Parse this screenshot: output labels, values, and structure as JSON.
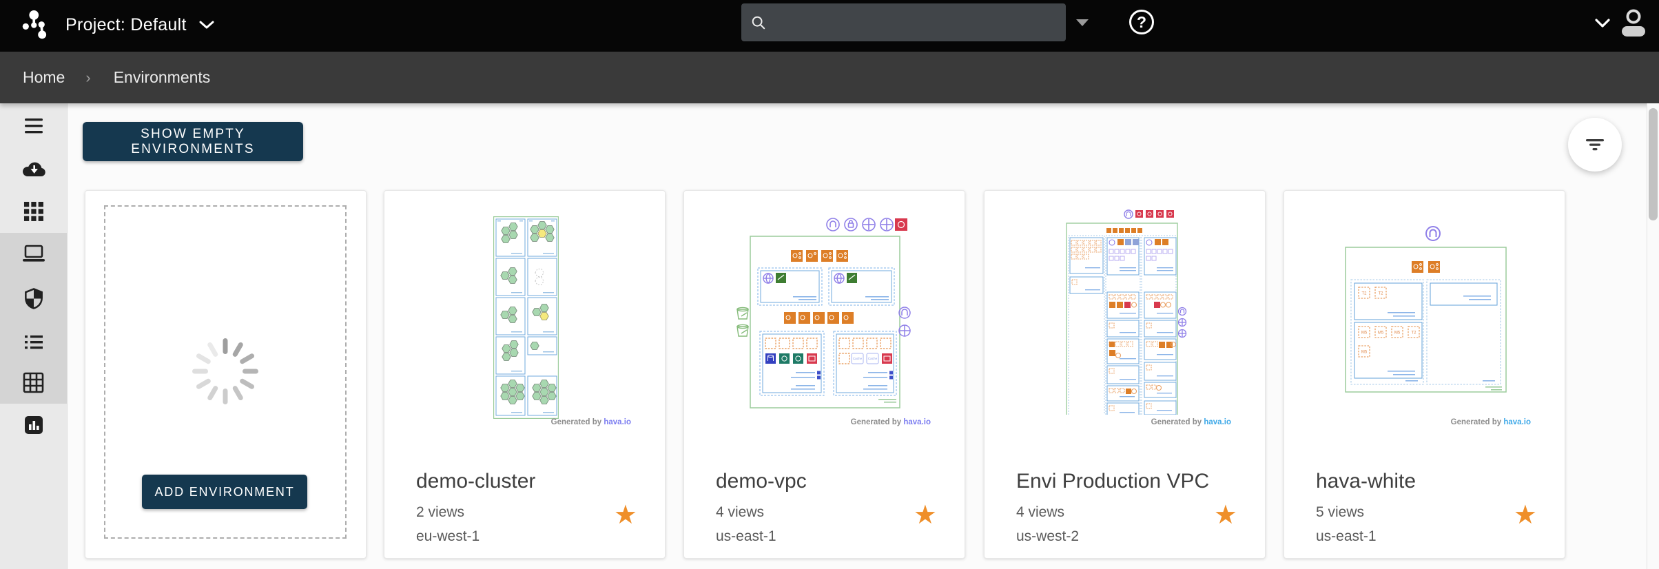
{
  "navbar": {
    "project_label": "Project: Default",
    "search": {
      "value": "",
      "placeholder": ""
    },
    "help_glyph": "?",
    "icons": {
      "logo": "hava-logo",
      "search": "magnifier",
      "search_scope": "dropdown-triangle",
      "help": "question-circle",
      "account_menu": "chevron-down",
      "account": "person"
    }
  },
  "breadcrumb": {
    "separator": "›",
    "items": [
      {
        "label": "Home"
      },
      {
        "label": "Environments"
      }
    ]
  },
  "sidebar": {
    "items": [
      {
        "icon": "menu"
      },
      {
        "icon": "cloud-download"
      },
      {
        "icon": "apps-grid"
      },
      {
        "icon": "laptop"
      },
      {
        "icon": "shield"
      },
      {
        "icon": "list"
      },
      {
        "icon": "table-grid"
      },
      {
        "icon": "bar-chart"
      }
    ]
  },
  "toolbar": {
    "show_empty_label": "SHOW EMPTY ENVIRONMENTS",
    "filter_icon": "filter-list"
  },
  "add_card": {
    "button_label": "ADD ENVIRONMENT",
    "spinner_icon": "loading-spinner"
  },
  "cards": {
    "generated_by_prefix": "Generated by",
    "generated_by_link": "hava.io",
    "star_glyph": "★",
    "environments": [
      {
        "title": "demo-cluster",
        "views": "2 views",
        "region": "eu-west-1",
        "starred": true,
        "link_color": "#7B7DF0"
      },
      {
        "title": "demo-vpc",
        "views": "4 views",
        "region": "us-east-1",
        "starred": true,
        "link_color": "#7B7DF0",
        "cache_label": "Cache"
      },
      {
        "title": "Envi Production VPC",
        "views": "4 views",
        "region": "us-west-2",
        "starred": true,
        "link_color": "#3FA9E8"
      },
      {
        "title": "hava-white",
        "views": "5 views",
        "region": "us-east-1",
        "starred": true,
        "link_color": "#3FA9E8",
        "t2_label": "T2",
        "m5_label": "M5"
      }
    ]
  },
  "colors": {
    "accent_navy": "#15384F",
    "star_orange": "#EF8F2A",
    "navbar_bg": "#060606",
    "breadcrumb_bg": "#3A3A3A",
    "diagram_green": "#9CCC9C",
    "diagram_blue": "#6FA8DC",
    "diagram_orange": "#DD7E27",
    "diagram_red": "#D8394E",
    "diagram_purple": "#8F7FE8"
  }
}
